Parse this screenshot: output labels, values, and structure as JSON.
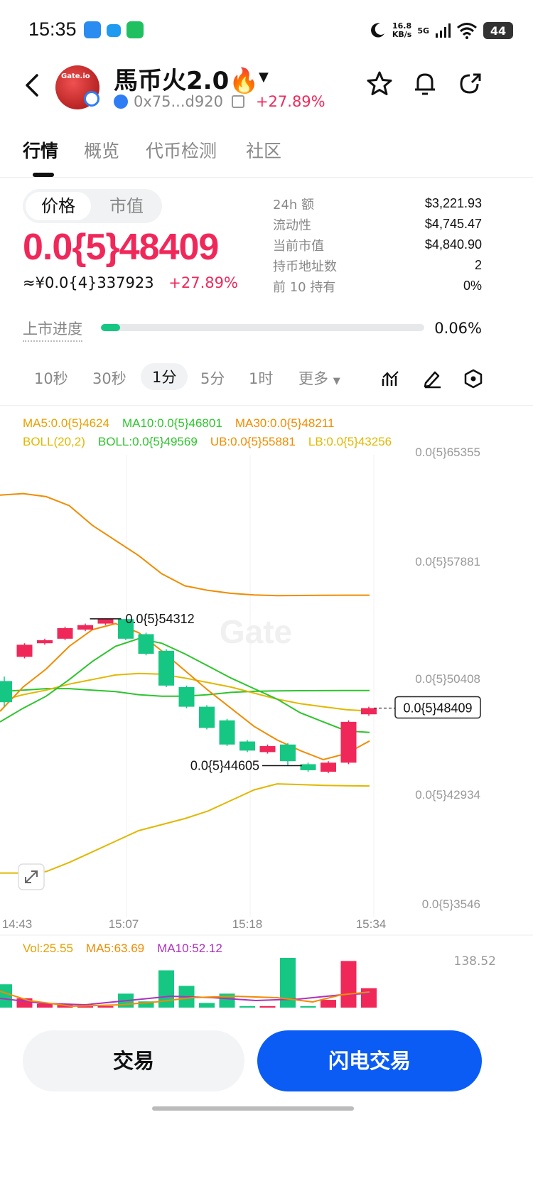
{
  "status_bar": {
    "time": "15:35",
    "net_speed_top": "16.8",
    "net_speed_unit": "KB/s",
    "network": "5G",
    "battery": "44"
  },
  "header": {
    "token_name": "馬币火2.0🔥",
    "contract": "0x75...d920",
    "change": "+27.89%",
    "avatar_text": "Gate.io"
  },
  "tabs": [
    "行情",
    "概览",
    "代币检测",
    "社区"
  ],
  "price": {
    "toggle_price": "价格",
    "toggle_mcap": "市值",
    "value": "0.0{5}48409",
    "cny": "≈¥0.0{4}337923",
    "change": "+27.89%"
  },
  "stats": [
    {
      "label": "24h  额",
      "value": "$3,221.93"
    },
    {
      "label": "流动性",
      "value": "$4,745.47"
    },
    {
      "label": "当前市值",
      "value": "$4,840.90"
    },
    {
      "label": "持币地址数",
      "value": "2"
    },
    {
      "label": "前 10 持有",
      "value": "0%"
    }
  ],
  "listing": {
    "label": "上市进度",
    "value": "0.06%",
    "fraction": 0.06
  },
  "intervals": [
    "10秒",
    "30秒",
    "1分",
    "5分",
    "1时",
    "更多"
  ],
  "colors": {
    "up": "#f0285a",
    "down": "#16c784",
    "ma5": "#e8a000",
    "ma10": "#2ec42e",
    "ma30": "#f08c00",
    "boll": "#e0b800",
    "accent": "#0a5cf5"
  },
  "chart_data": {
    "type": "candlestick",
    "ma_legend": {
      "ma5": "MA5:0.0{5}4624",
      "ma10": "MA10:0.0{5}46801",
      "ma30": "MA30:0.0{5}48211",
      "boll": "BOLL(20,2)",
      "boll_mid": "BOLL:0.0{5}49569",
      "ub": "UB:0.0{5}55881",
      "lb": "LB:0.0{5}43256"
    },
    "y_ticks": [
      "0.0{5}65355",
      "0.0{5}57881",
      "0.0{5}50408",
      "0.0{5}42934",
      "0.0{5}3546"
    ],
    "x_ticks": [
      "14:43",
      "15:07",
      "15:18",
      "15:34"
    ],
    "high_label": "0.0{5}54312",
    "low_label": "0.0{5}44605",
    "last_label": "0.0{5}48409",
    "volume": {
      "vol": "Vol:25.55",
      "ma5": "MA5:63.69",
      "ma10": "MA10:52.12",
      "max": "138.52"
    },
    "candles": [
      {
        "o": 50200,
        "c": 48800,
        "h": 50500,
        "l": 48500
      },
      {
        "o": 51800,
        "c": 52600,
        "h": 52700,
        "l": 51700
      },
      {
        "o": 52700,
        "c": 52900,
        "h": 53000,
        "l": 52600
      },
      {
        "o": 53000,
        "c": 53700,
        "h": 53800,
        "l": 52900
      },
      {
        "o": 53600,
        "c": 53900,
        "h": 54000,
        "l": 53500
      },
      {
        "o": 54000,
        "c": 54300,
        "h": 54312,
        "l": 53900
      },
      {
        "o": 54300,
        "c": 53000,
        "h": 54312,
        "l": 52900
      },
      {
        "o": 53300,
        "c": 52000,
        "h": 53400,
        "l": 51900
      },
      {
        "o": 52200,
        "c": 49900,
        "h": 52300,
        "l": 49800
      },
      {
        "o": 49800,
        "c": 48500,
        "h": 49900,
        "l": 48400
      },
      {
        "o": 48500,
        "c": 47100,
        "h": 48600,
        "l": 47000
      },
      {
        "o": 47600,
        "c": 46000,
        "h": 47700,
        "l": 45900
      },
      {
        "o": 46200,
        "c": 45600,
        "h": 46300,
        "l": 45500
      },
      {
        "o": 45500,
        "c": 45900,
        "h": 46000,
        "l": 45400
      },
      {
        "o": 46000,
        "c": 44900,
        "h": 46100,
        "l": 44605
      },
      {
        "o": 44700,
        "c": 44300,
        "h": 44800,
        "l": 44200
      },
      {
        "o": 44200,
        "c": 44800,
        "h": 44900,
        "l": 44100
      },
      {
        "o": 44800,
        "c": 47500,
        "h": 47600,
        "l": 44700
      },
      {
        "o": 48000,
        "c": 48409,
        "h": 48500,
        "l": 47900
      }
    ],
    "volumes": [
      30,
      12,
      5,
      4,
      3,
      2,
      18,
      8,
      48,
      28,
      6,
      18,
      2,
      2,
      64,
      2,
      10,
      60,
      25
    ],
    "ub": [
      62500,
      62600,
      62400,
      61800,
      60500,
      59500,
      58500,
      57300,
      56500,
      56200,
      56000,
      55900,
      55850,
      55860,
      55870,
      55880,
      55881
    ],
    "lb": [
      37500,
      37500,
      37600,
      38200,
      38900,
      39600,
      40300,
      40700,
      41100,
      41600,
      42300,
      43000,
      43400,
      43350,
      43300,
      43270,
      43256
    ],
    "ma5": [
      48200,
      49800,
      51000,
      52500,
      53600,
      54000,
      53400,
      52200,
      50900,
      49600,
      48400,
      47200,
      46300,
      45600,
      45000,
      45400,
      46240
    ],
    "ma10": [
      47500,
      48400,
      49200,
      50300,
      51500,
      52500,
      53000,
      52700,
      52000,
      51200,
      50400,
      49700,
      49000,
      48100,
      47500,
      46900,
      46801
    ],
    "ma30": [
      48900,
      49300,
      49600,
      50000,
      50300,
      50600,
      50700,
      50650,
      50400,
      50100,
      49800,
      49400,
      49000,
      48700,
      48500,
      48300,
      48211
    ],
    "boll_mid": [
      49500,
      49600,
      49700,
      49700,
      49600,
      49500,
      49300,
      49200,
      49200,
      49300,
      49450,
      49520,
      49550,
      49560,
      49565,
      49569,
      49569
    ]
  },
  "buttons": {
    "trade": "交易",
    "flash_trade": "闪电交易"
  }
}
